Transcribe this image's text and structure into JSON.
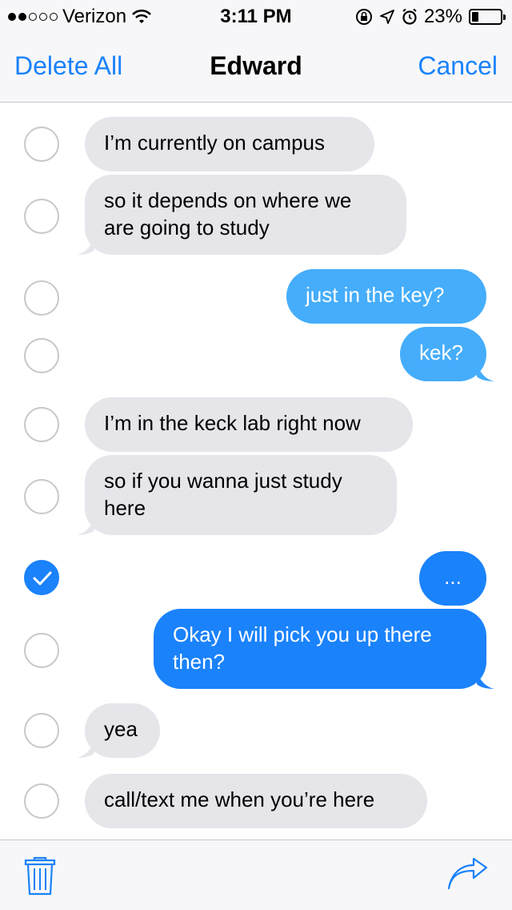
{
  "status": {
    "carrier": "Verizon",
    "time": "3:11 PM",
    "battery": "23%",
    "signal_bars_filled": 2,
    "signal_bars_total": 5
  },
  "nav": {
    "left_label": "Delete All",
    "title": "Edward",
    "right_label": "Cancel"
  },
  "messages": [
    {
      "text": "I’m currently on campus",
      "direction": "incoming",
      "selected": false
    },
    {
      "text": "so it depends on where we are going to study",
      "direction": "incoming",
      "selected": false
    },
    {
      "text": "just in the key?",
      "direction": "outgoing",
      "selected": false
    },
    {
      "text": "kek?",
      "direction": "outgoing",
      "selected": false
    },
    {
      "text": "I’m in the keck lab right now",
      "direction": "incoming",
      "selected": false
    },
    {
      "text": "so if you wanna just study here",
      "direction": "incoming",
      "selected": false
    },
    {
      "text": "...",
      "direction": "outgoing",
      "selected": true
    },
    {
      "text": "Okay I will pick you up there then?",
      "direction": "outgoing",
      "selected": false
    },
    {
      "text": "yea",
      "direction": "incoming",
      "selected": false
    },
    {
      "text": "call/text me when you’re here",
      "direction": "incoming",
      "selected": false
    }
  ],
  "toolbar": {
    "left_icon": "trash-icon",
    "right_icon": "share-icon"
  },
  "colors": {
    "accent": "#1a82fb",
    "outgoing_light": "#45adfb",
    "incoming_bg": "#e5e5ea"
  }
}
